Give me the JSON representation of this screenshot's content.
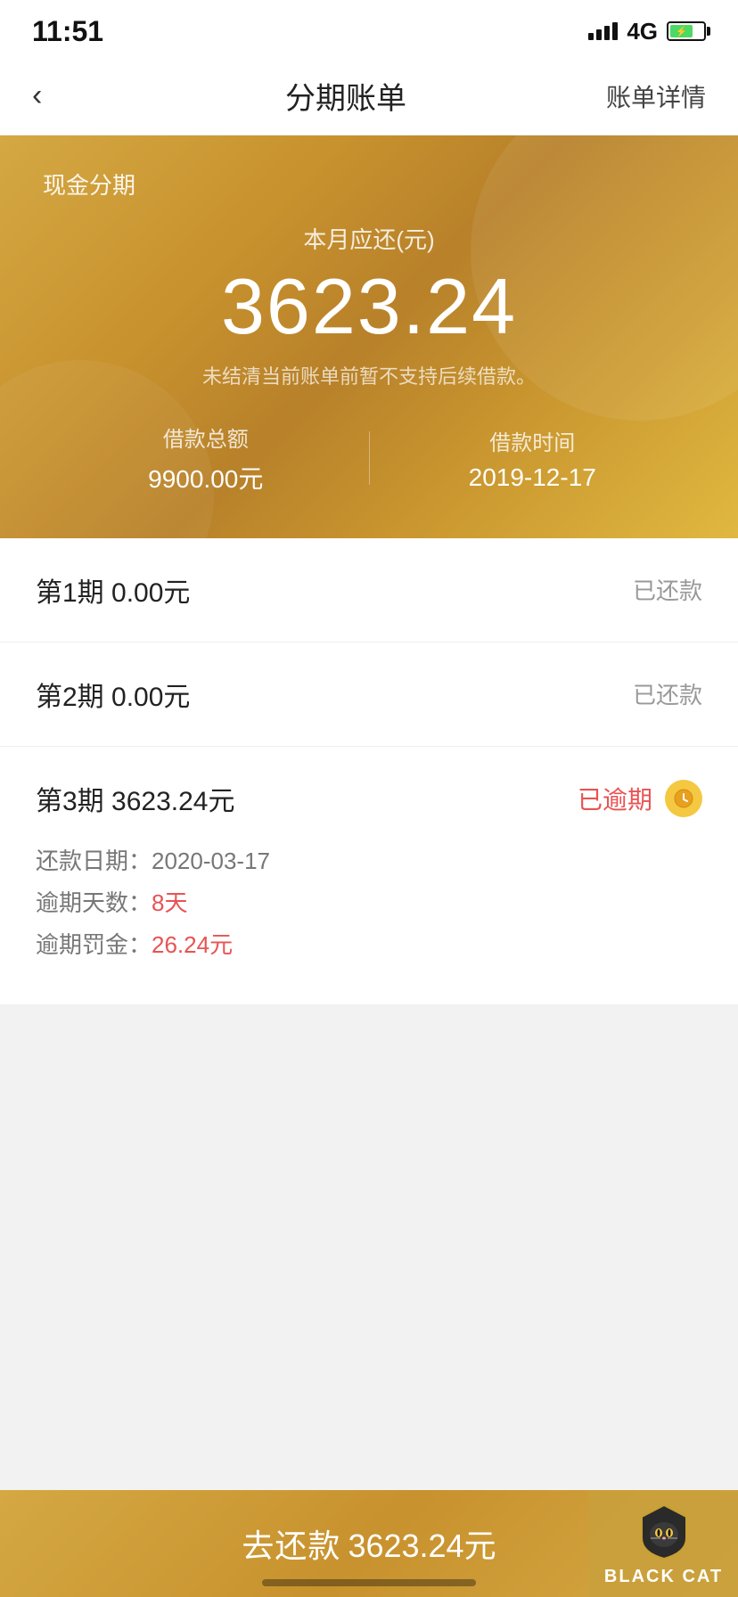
{
  "statusBar": {
    "time": "11:51",
    "signal": "4G"
  },
  "navBar": {
    "backLabel": "‹",
    "title": "分期账单",
    "detailLabel": "账单详情"
  },
  "hero": {
    "productLabel": "现金分期",
    "monthLabel": "本月应还(元)",
    "amount": "3623.24",
    "notice": "未结清当前账单前暂不支持后续借款。",
    "loanAmountLabel": "借款总额",
    "loanAmountValue": "9900.00元",
    "loanDateLabel": "借款时间",
    "loanDateValue": "2019-12-17"
  },
  "installments": [
    {
      "id": "1",
      "title": "第1期  0.00元",
      "status": "已还款",
      "statusType": "paid"
    },
    {
      "id": "2",
      "title": "第2期  0.00元",
      "status": "已还款",
      "statusType": "paid"
    },
    {
      "id": "3",
      "title": "第3期  3623.24元",
      "status": "已逾期",
      "statusType": "overdue",
      "repayDateLabel": "还款日期：",
      "repayDateValue": "2020-03-17",
      "overdueDaysLabel": "逾期天数：",
      "overdueDaysValue": "8天",
      "overdueFineLabel": "逾期罚金：",
      "overdueFineValue": "26.24元"
    }
  ],
  "bottomBar": {
    "payLabel": "去还款",
    "payAmount": "3623.24元"
  },
  "blackCat": {
    "text": "BLACK CAT"
  }
}
